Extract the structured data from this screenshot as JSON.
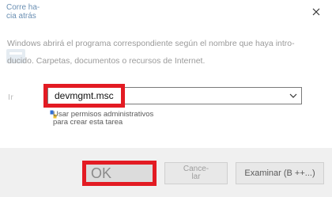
{
  "window": {
    "title": "Corre ha-\ncia atrás",
    "close_glyph": "✕"
  },
  "dialog": {
    "description": "Windows abrirá el programa correspondiente según el nombre que haya intro-\nducido. Carpetas, documentos o recursos de Internet.",
    "open_label": "Ir",
    "open_value": "devmgmt.msc",
    "admin_note": "Usar permisos administrativos\npara crear esta tarea"
  },
  "buttons": {
    "ok": "OK",
    "cancel": "Cance-\nlar",
    "browse": "Examinar (B ++...)"
  },
  "colors": {
    "highlight": "#e31b23",
    "title_text": "#6a8fb3"
  }
}
